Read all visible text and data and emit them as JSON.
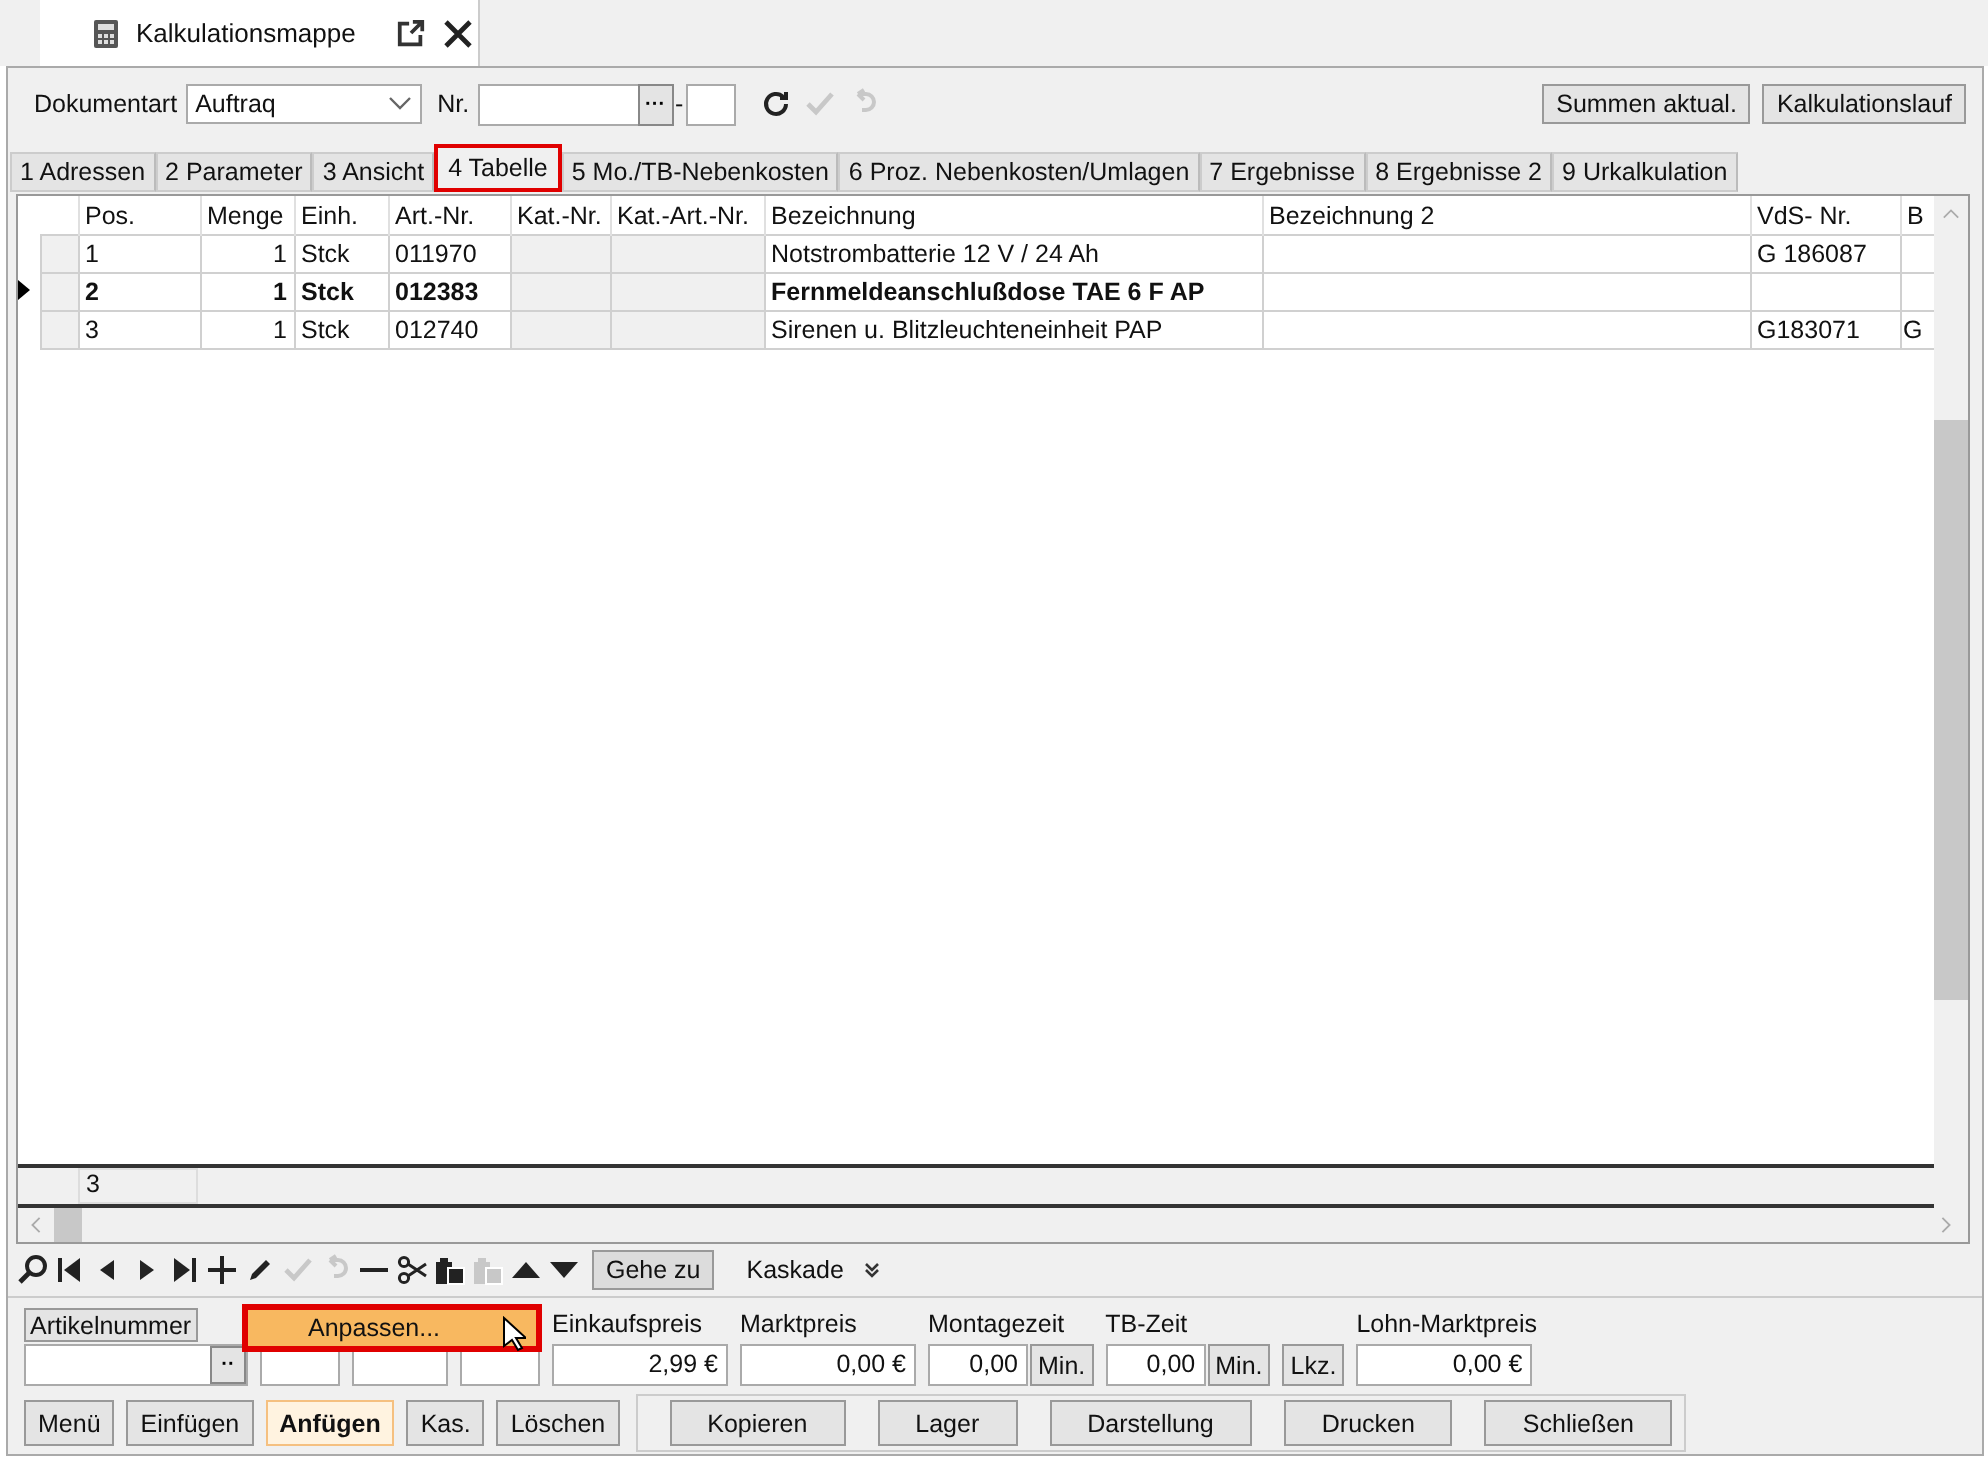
{
  "document_tab": {
    "title": "Kalkulationsmappe"
  },
  "toolbar": {
    "doc_type_label": "Dokumentart",
    "doc_type_value": "Auftraq",
    "nr_label": "Nr.",
    "nr_button": "···",
    "nr_sep": "-",
    "tools": [
      {
        "kind": "refresh",
        "disabled": false
      },
      {
        "kind": "check",
        "disabled": true
      },
      {
        "kind": "undo",
        "disabled": true
      }
    ],
    "buttons": [
      "Summen aktual.",
      "Kalkulationslauf"
    ]
  },
  "tabs": [
    {
      "label": "1 Adressen",
      "selected": false
    },
    {
      "label": "2 Parameter",
      "selected": false
    },
    {
      "label": "3 Ansicht",
      "selected": false
    },
    {
      "label": "4 Tabelle",
      "selected": true
    },
    {
      "label": "5 Mo./TB-Nebenkosten",
      "selected": false
    },
    {
      "label": "6 Proz. Nebenkosten/Umlagen",
      "selected": false
    },
    {
      "label": "7 Ergebnisse",
      "selected": false
    },
    {
      "label": "8 Ergebnisse 2",
      "selected": false
    },
    {
      "label": "9 Urkalkulation",
      "selected": false
    }
  ],
  "table": {
    "columns": [
      "Pos.",
      "Menge",
      "Einh.",
      "Art.-Nr.",
      "Kat.-Nr.",
      "Kat.-Art.-Nr.",
      "Bezeichnung",
      "Bezeichnung 2",
      "VdS- Nr.",
      "B"
    ],
    "rows": [
      {
        "selected": false,
        "cells": [
          "1",
          "1",
          "Stck",
          "011970",
          "",
          "",
          "Notstrombatterie 12 V / 24 Ah",
          "",
          "G 186087",
          ""
        ]
      },
      {
        "selected": true,
        "cells": [
          "2",
          "1",
          "Stck",
          "012383",
          "",
          "",
          "Fernmeldeanschlußdose TAE 6 F AP",
          "",
          "",
          ""
        ]
      },
      {
        "selected": false,
        "cells": [
          "3",
          "1",
          "Stck",
          "012740",
          "",
          "",
          "Sirenen u. Blitzleuchteneinheit PAP",
          "",
          "G183071",
          "G"
        ]
      }
    ],
    "footer_count": "3"
  },
  "nav_tools": [
    {
      "kind": "search",
      "disabled": false
    },
    {
      "kind": "first",
      "disabled": false
    },
    {
      "kind": "prev",
      "disabled": false
    },
    {
      "kind": "next",
      "disabled": false
    },
    {
      "kind": "last",
      "disabled": false
    },
    {
      "kind": "plus",
      "disabled": false
    },
    {
      "kind": "pencil",
      "disabled": false
    },
    {
      "kind": "check",
      "disabled": true
    },
    {
      "kind": "undo",
      "disabled": true
    },
    {
      "kind": "minus",
      "disabled": false
    },
    {
      "kind": "scissors",
      "disabled": false
    },
    {
      "kind": "paste",
      "disabled": false
    },
    {
      "kind": "paste",
      "disabled": true
    },
    {
      "kind": "up",
      "disabled": false
    },
    {
      "kind": "down",
      "disabled": false
    }
  ],
  "goto_button": "Gehe zu",
  "cascade_label": "Kaskade",
  "fields": {
    "article_label": "Artikelnummer",
    "article_button": "··",
    "einkauf_label": "Einkaufspreis",
    "einkauf_value": "2,99 €",
    "markt_label": "Marktpreis",
    "markt_value": "0,00 €",
    "montage_label": "Montagezeit",
    "montage_value": "0,00",
    "montage_unit": "Min.",
    "tb_label": "TB-Zeit",
    "tb_value": "0,00",
    "tb_unit": "Min.",
    "lkz_button": "Lkz.",
    "lohn_label": "Lohn-Marktpreis",
    "lohn_value": "0,00 €"
  },
  "context_menu": {
    "items": [
      "Anpassen..."
    ]
  },
  "buttons_left": [
    {
      "label": "Menü",
      "selected": false
    },
    {
      "label": "Einfügen",
      "selected": false
    },
    {
      "label": "Anfügen",
      "selected": true
    },
    {
      "label": "Kas.",
      "selected": false
    },
    {
      "label": "Löschen",
      "selected": false
    }
  ],
  "buttons_right": [
    "Kopieren",
    "Lager",
    "Darstellung",
    "Drucken",
    "Schließen"
  ]
}
